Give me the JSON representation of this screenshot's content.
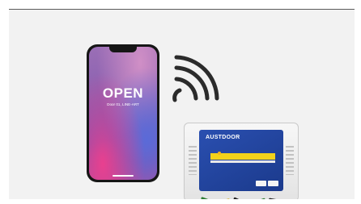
{
  "phone": {
    "headline": "OPEN",
    "subtitle": "Door 01, LINE-ART"
  },
  "controller": {
    "brand": "AUSTDOOR"
  },
  "colors": {
    "panel_blue": "#1b3a8c",
    "strip_yellow": "#f2d21a",
    "frame_bg": "#f2f2f2"
  }
}
